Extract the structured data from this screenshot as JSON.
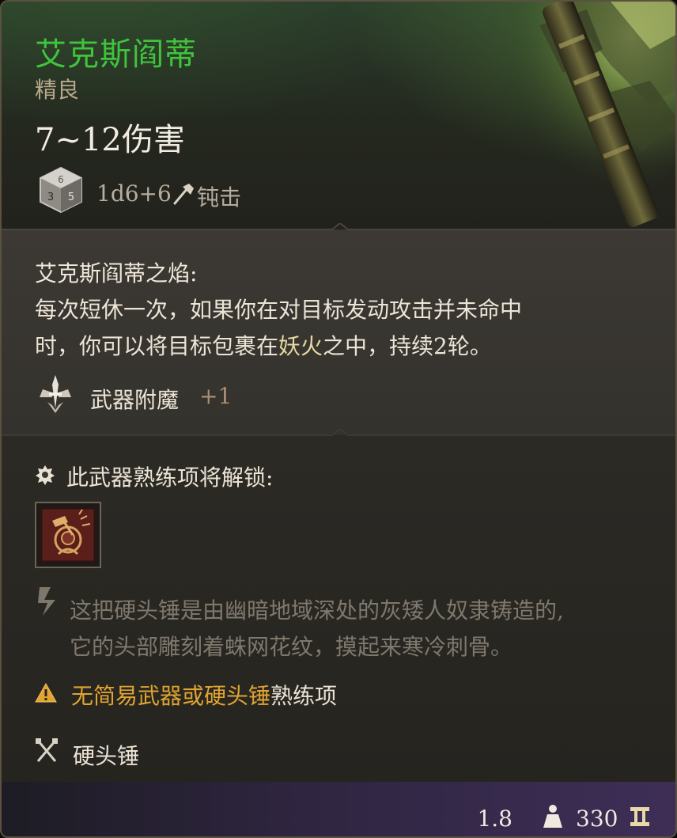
{
  "item": {
    "name": "艾克斯阎蒂",
    "rarity": "精良",
    "damage_range": "7~12伤害",
    "dice": "1d6+6",
    "damage_type": "钝击"
  },
  "effect": {
    "title": "艾克斯阎蒂之焰:",
    "line1": "每次短休一次，如果你在对目标发动攻击并未命中",
    "line2_pre": "时，你可以将目标包裹在",
    "line2_highlight": "妖火",
    "line2_post": "之中，持续2轮。"
  },
  "enchantment": {
    "label": "武器附魔",
    "bonus": "+1"
  },
  "proficiency": {
    "title": "此武器熟练项将解锁:"
  },
  "description": {
    "line1": "这把硬头锤是由幽暗地域深处的灰矮人奴隶铸造的,",
    "line2": "它的头部雕刻着蛛网花纹，摸起来寒冷刺骨。"
  },
  "warning": {
    "text": "无简易武器或硬头锤",
    "suffix": "熟练项"
  },
  "weapon_type": "硬头锤",
  "footer": {
    "weight": "1.8",
    "price": "330"
  },
  "colors": {
    "name_green": "#3fc43c",
    "warning_orange": "#e0a431",
    "highlight_gold": "#e7d7a2"
  },
  "icons": {
    "dice": "d6-dice-icon",
    "damage_type": "bludgeon-hammer-icon",
    "enchant": "weapon-enchant-icon",
    "unlock": "proficiency-unlock-icon",
    "proficiency_action": "concussive-smash-icon",
    "description": "lore-icon",
    "warning": "warning-triangle-icon",
    "weapon_type": "crossed-weapons-icon",
    "weight": "weight-icon",
    "price": "gold-coin-icon"
  }
}
